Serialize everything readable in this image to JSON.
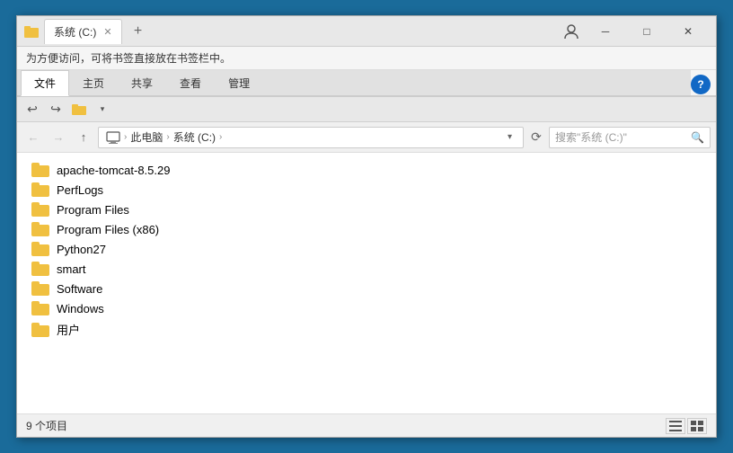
{
  "window": {
    "title": "系统 (C:)",
    "tab_label": "系统 (C:)",
    "profile_icon": "👤"
  },
  "bookmark_bar": {
    "message": "为方便访问，可将书签直接放在书签栏中。"
  },
  "ribbon": {
    "tabs": [
      {
        "id": "file",
        "label": "文件",
        "active": true
      },
      {
        "id": "home",
        "label": "主页",
        "active": false
      },
      {
        "id": "share",
        "label": "共享",
        "active": false
      },
      {
        "id": "view",
        "label": "查看",
        "active": false
      },
      {
        "id": "manage",
        "label": "管理",
        "active": false
      }
    ],
    "help_label": "?"
  },
  "quick_access": {
    "back_label": "↩",
    "forward_label": "↪",
    "folder_label": "📁",
    "dropdown_label": "▾"
  },
  "address_bar": {
    "back_label": "←",
    "forward_label": "→",
    "up_label": "↑",
    "path_icon": "🖥",
    "path_parts": [
      "此电脑",
      "系统 (C:)"
    ],
    "dropdown_label": "▾",
    "refresh_label": "⟳",
    "search_placeholder": "搜索\"系统 (C:)\""
  },
  "files": [
    {
      "name": "apache-tomcat-8.5.29"
    },
    {
      "name": "PerfLogs"
    },
    {
      "name": "Program Files"
    },
    {
      "name": "Program Files (x86)"
    },
    {
      "name": "Python27"
    },
    {
      "name": "smart"
    },
    {
      "name": "Software"
    },
    {
      "name": "Windows"
    },
    {
      "name": "用户"
    }
  ],
  "status_bar": {
    "count_label": "9 个项目",
    "view_list_label": "≡",
    "view_grid_label": "⊞"
  }
}
